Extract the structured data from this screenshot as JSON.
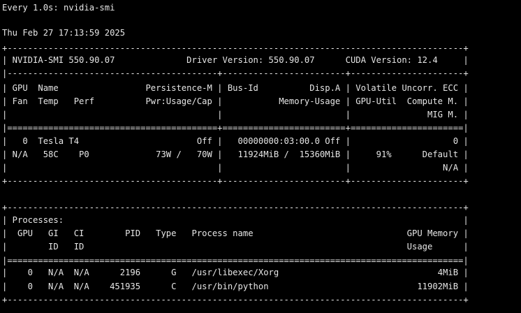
{
  "terminal": {
    "text_color": "#e6e6e6",
    "background_color": "#000000",
    "watch_header": "Every 1.0s: nvidia-smi",
    "timestamp": "Thu Feb 27 17:13:59 2025",
    "lines": [
      "+-----------------------------------------------------------------------------------------+",
      "| NVIDIA-SMI 550.90.07              Driver Version: 550.90.07      CUDA Version: 12.4     |",
      "|-----------------------------------------+------------------------+----------------------+",
      "| GPU  Name                 Persistence-M | Bus-Id          Disp.A | Volatile Uncorr. ECC |",
      "| Fan  Temp   Perf          Pwr:Usage/Cap |           Memory-Usage | GPU-Util  Compute M. |",
      "|                                         |                        |               MIG M. |",
      "|=========================================+========================+======================|",
      "|   0  Tesla T4                       Off |   00000000:03:00.0 Off |                    0 |",
      "| N/A   58C    P0             73W /   70W |   11924MiB /  15360MiB |     91%      Default |",
      "|                                         |                        |                  N/A |",
      "+-----------------------------------------+------------------------+----------------------+",
      "",
      "+-----------------------------------------------------------------------------------------+",
      "| Processes:                                                                              |",
      "|  GPU   GI   CI        PID   Type   Process name                              GPU Memory |",
      "|        ID   ID                                                               Usage      |",
      "|=========================================================================================|",
      "|    0   N/A  N/A      2196      G   /usr/libexec/Xorg                               4MiB |",
      "|    0   N/A  N/A    451935      C   /usr/bin/python                             11902MiB |",
      "+-----------------------------------------------------------------------------------------+"
    ]
  }
}
